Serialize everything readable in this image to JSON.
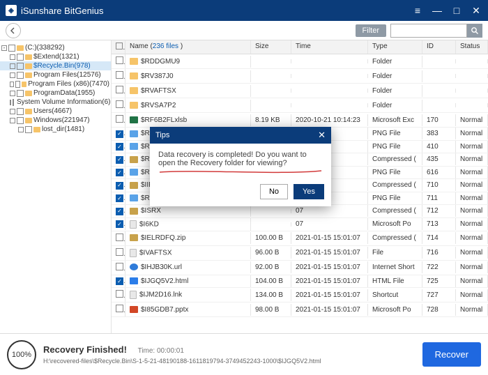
{
  "app": {
    "title": "iSunshare BitGenius"
  },
  "winctl": {
    "menu": "≡",
    "min": "—",
    "max": "□",
    "close": "✕"
  },
  "toolbar": {
    "filter": "Filter",
    "search_placeholder": ""
  },
  "tree": [
    {
      "level": 0,
      "exp": "-",
      "label": "(C:)(338292)",
      "sel": false
    },
    {
      "level": 1,
      "exp": "",
      "label": "$Extend(1321)",
      "sel": false
    },
    {
      "level": 1,
      "exp": "",
      "label": "$Recycle.Bin(978)",
      "sel": true,
      "blue": true
    },
    {
      "level": 1,
      "exp": "",
      "label": "Program Files(12576)",
      "sel": false
    },
    {
      "level": 1,
      "exp": "",
      "label": "Program Files (x86)(7470)",
      "sel": false
    },
    {
      "level": 1,
      "exp": "",
      "label": "ProgramData(1955)",
      "sel": false
    },
    {
      "level": 1,
      "exp": "",
      "label": "System Volume Information(6)",
      "sel": false
    },
    {
      "level": 1,
      "exp": "",
      "label": "Users(4667)",
      "sel": false
    },
    {
      "level": 1,
      "exp": "",
      "label": "Windows(221947)",
      "sel": false
    },
    {
      "level": 2,
      "exp": "",
      "label": "lost_dir(1481)",
      "sel": false
    }
  ],
  "columns": {
    "name_pre": "Name (",
    "name_link": "236 files",
    "name_post": " )",
    "size": "Size",
    "time": "Time",
    "type": "Type",
    "id": "ID",
    "status": "Status"
  },
  "files": [
    {
      "ck": false,
      "icon": "fld",
      "name": "$RDDGMU9",
      "size": "",
      "time": "",
      "type": "Folder",
      "id": "",
      "status": ""
    },
    {
      "ck": false,
      "icon": "fld",
      "name": "$RV387J0",
      "size": "",
      "time": "",
      "type": "Folder",
      "id": "",
      "status": ""
    },
    {
      "ck": false,
      "icon": "fld",
      "name": "$RVAFTSX",
      "size": "",
      "time": "",
      "type": "Folder",
      "id": "",
      "status": ""
    },
    {
      "ck": false,
      "icon": "fld",
      "name": "$RVSA7P2",
      "size": "",
      "time": "",
      "type": "Folder",
      "id": "",
      "status": ""
    },
    {
      "ck": false,
      "icon": "xls",
      "name": "$RF6B2FLxlsb",
      "size": "8.19 KB",
      "time": "2020-10-21 10:14:23",
      "type": "Microsoft Exc",
      "id": "170",
      "status": "Normal"
    },
    {
      "ck": true,
      "icon": "img",
      "name": "$RZL",
      "size": "",
      "time": "16",
      "type": "PNG File",
      "id": "383",
      "status": "Normal"
    },
    {
      "ck": true,
      "icon": "img",
      "name": "$RRT",
      "size": "",
      "time": "02",
      "type": "PNG File",
      "id": "410",
      "status": "Normal"
    },
    {
      "ck": true,
      "icon": "zip",
      "name": "$RIB",
      "size": "",
      "time": "08",
      "type": "Compressed (",
      "id": "435",
      "status": "Normal"
    },
    {
      "ck": true,
      "icon": "img",
      "name": "$RM",
      "size": "",
      "time": "34",
      "type": "PNG File",
      "id": "616",
      "status": "Normal"
    },
    {
      "ck": true,
      "icon": "zip",
      "name": "$IIRK",
      "size": "",
      "time": "07",
      "type": "Compressed (",
      "id": "710",
      "status": "Normal"
    },
    {
      "ck": true,
      "icon": "img",
      "name": "$RNO",
      "size": "",
      "time": "33",
      "type": "PNG File",
      "id": "711",
      "status": "Normal"
    },
    {
      "ck": true,
      "icon": "zip",
      "name": "$ISRX",
      "size": "",
      "time": "07",
      "type": "Compressed (",
      "id": "712",
      "status": "Normal"
    },
    {
      "ck": true,
      "icon": "doc",
      "name": "$I6KD",
      "size": "",
      "time": "07",
      "type": "Microsoft Po",
      "id": "713",
      "status": "Normal"
    },
    {
      "ck": false,
      "icon": "zip",
      "name": "$IELRDFQ.zip",
      "size": "100.00 B",
      "time": "2021-01-15 15:01:07",
      "type": "Compressed (",
      "id": "714",
      "status": "Normal"
    },
    {
      "ck": false,
      "icon": "doc",
      "name": "$IVAFTSX",
      "size": "96.00 B",
      "time": "2021-01-15 15:01:07",
      "type": "File",
      "id": "716",
      "status": "Normal"
    },
    {
      "ck": false,
      "icon": "web",
      "name": "$IHJB30K.url",
      "size": "92.00 B",
      "time": "2021-01-15 15:01:07",
      "type": "Internet Short",
      "id": "722",
      "status": "Normal"
    },
    {
      "ck": true,
      "icon": "html",
      "name": "$IJGQ5V2.html",
      "size": "104.00 B",
      "time": "2021-01-15 15:01:07",
      "type": "HTML File",
      "id": "725",
      "status": "Normal"
    },
    {
      "ck": false,
      "icon": "doc",
      "name": "$IJM2D16.lnk",
      "size": "134.00 B",
      "time": "2021-01-15 15:01:07",
      "type": "Shortcut",
      "id": "727",
      "status": "Normal"
    },
    {
      "ck": false,
      "icon": "ppt",
      "name": "$I85GDB7.pptx",
      "size": "98.00 B",
      "time": "2021-01-15 15:01:07",
      "type": "Microsoft Po",
      "id": "728",
      "status": "Normal"
    }
  ],
  "dialog": {
    "title": "Tips",
    "message": "Data recovery is completed! Do you want to open the Recovery folder for viewing?",
    "no": "No",
    "yes": "Yes",
    "close": "✕"
  },
  "status": {
    "pct": "100%",
    "heading": "Recovery Finished!",
    "time_label": "Time:",
    "time_value": "00:00:01",
    "path": "H:\\recovered-files\\$Recycle.Bin\\S-1-5-21-48190188-1611819794-3749452243-1000\\$IJGQ5V2.html",
    "button": "Recover"
  }
}
